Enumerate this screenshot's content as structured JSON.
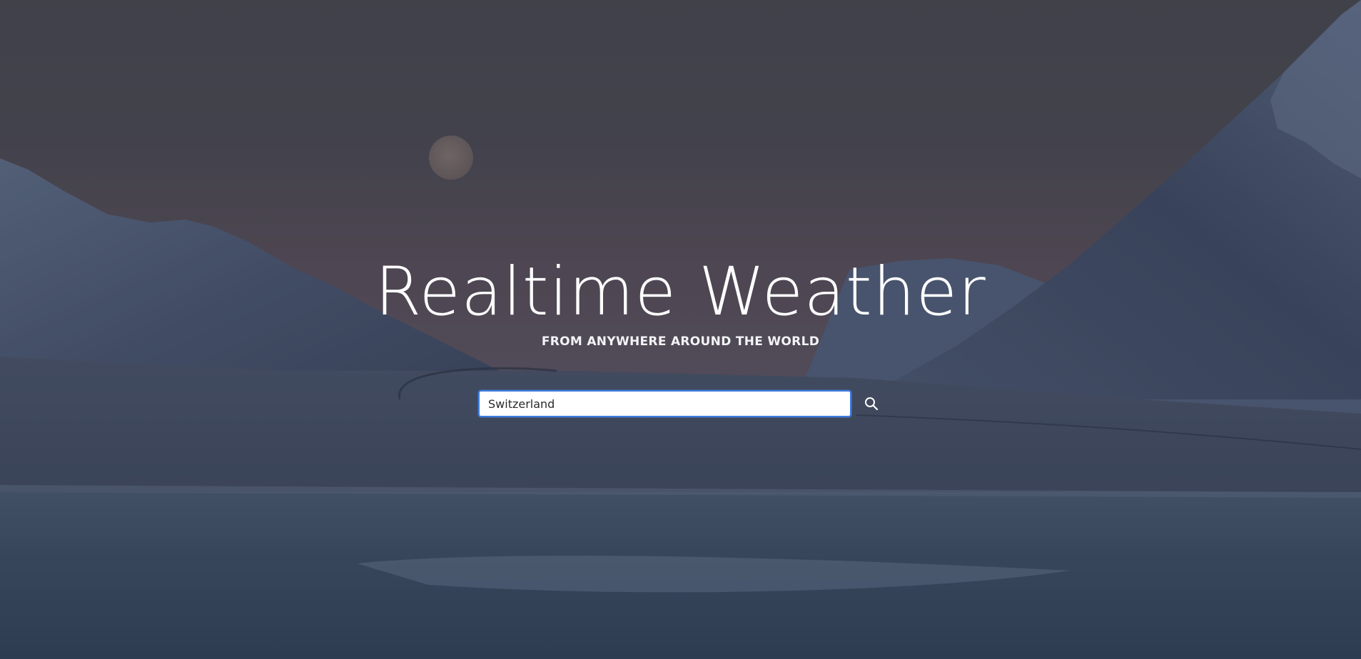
{
  "hero": {
    "title": "Realtime Weather",
    "subtitle": "FROM ANYWHERE AROUND THE WORLD"
  },
  "search": {
    "value": "Switzerland",
    "placeholder": "",
    "button_icon": "search-icon"
  },
  "colors": {
    "input_border": "#3b7de0",
    "text": "#ffffff"
  }
}
